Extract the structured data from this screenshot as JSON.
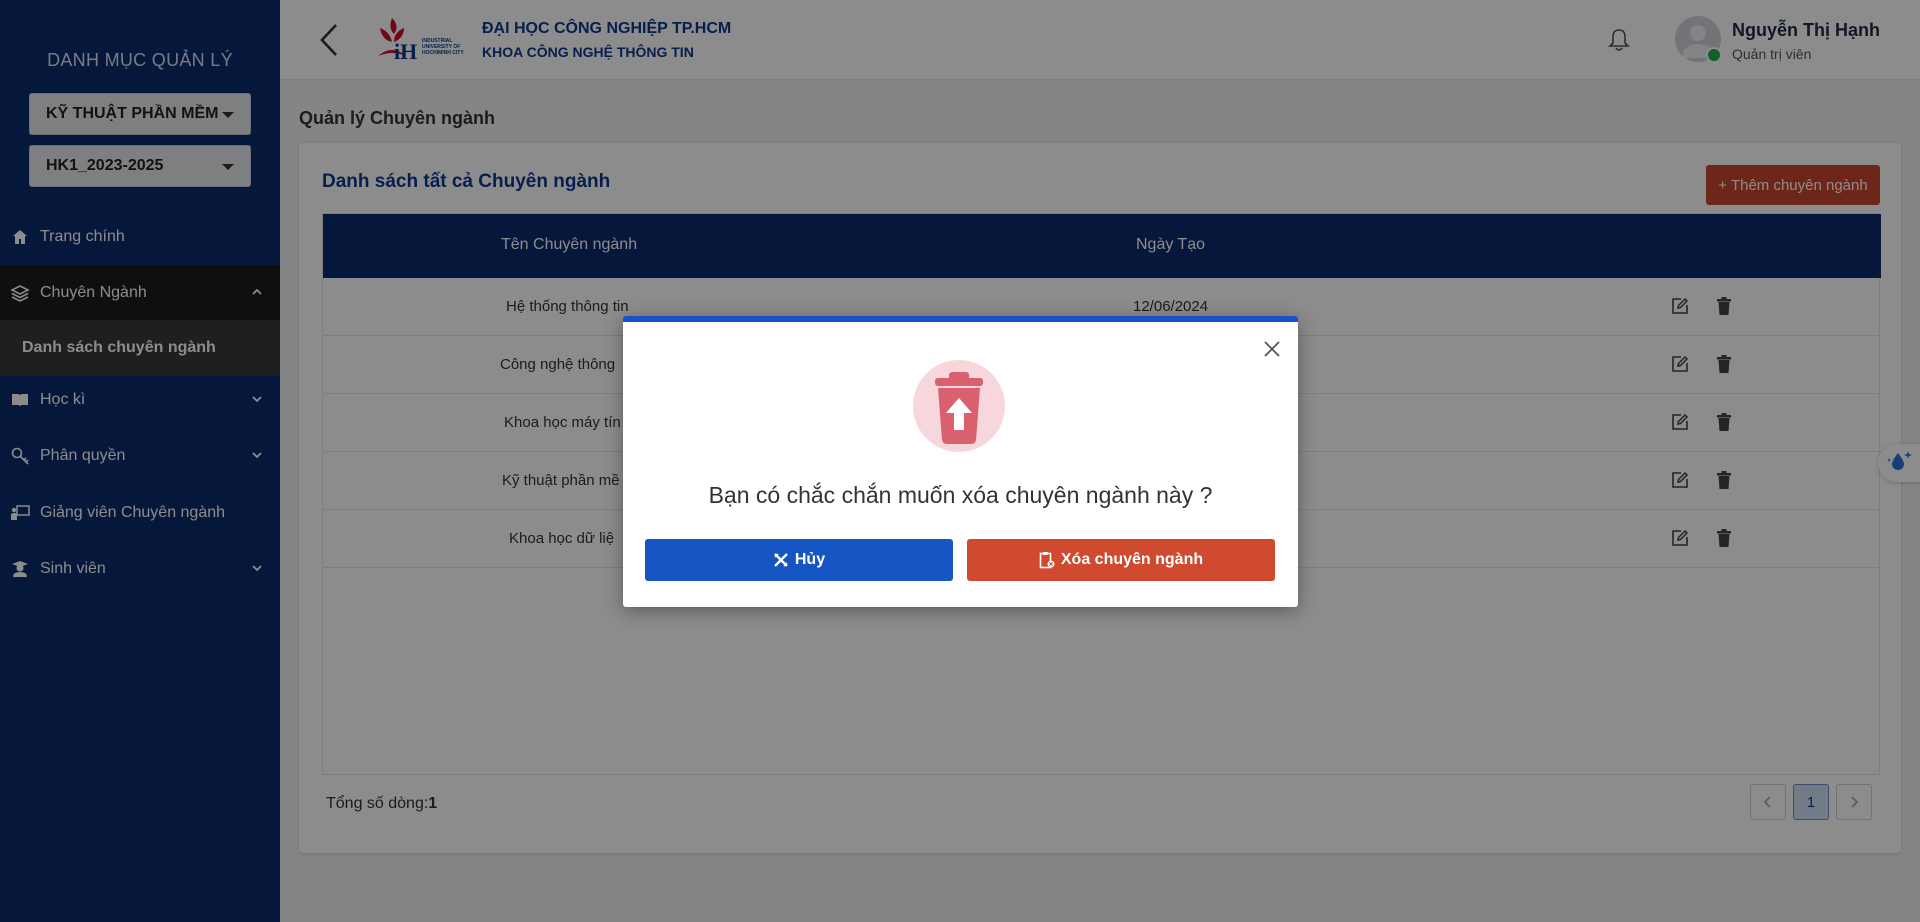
{
  "sidebar": {
    "title": "DANH MỤC QUẢN LÝ",
    "select_major": "KỸ THUẬT PHẦN MỀM",
    "select_term": "HK1_2023-2025",
    "items": [
      {
        "label": "Trang chính"
      },
      {
        "label": "Chuyên Ngành"
      },
      {
        "label": "Danh sách chuyên ngành"
      },
      {
        "label": "Học kì"
      },
      {
        "label": "Phân quyền"
      },
      {
        "label": "Giảng viên Chuyên ngành"
      },
      {
        "label": "Sinh viên"
      }
    ]
  },
  "header": {
    "university": "ĐẠI HỌC CÔNG NGHIỆP TP.HCM",
    "faculty": "KHOA CÔNG NGHỆ THÔNG TIN",
    "user_name": "Nguyễn Thị Hạnh",
    "user_role": "Quản trị viên"
  },
  "main": {
    "page_title": "Quản lý Chuyên ngành",
    "card_title": "Danh sách tất cả Chuyên ngành",
    "add_button": "+ Thêm chuyên ngành",
    "columns": [
      "Tên Chuyên ngành",
      "Ngày Tạo"
    ],
    "rows": [
      {
        "name": "Hệ thống thông tin",
        "date": "12/06/2024"
      },
      {
        "name": "Công nghệ thông",
        "date": ""
      },
      {
        "name": "Khoa học máy tín",
        "date": ""
      },
      {
        "name": "Kỹ thuật phần mề",
        "date": ""
      },
      {
        "name": "Khoa học dữ liệ",
        "date": ""
      }
    ],
    "total_label": "Tổng số dòng:",
    "total_value": "1",
    "current_page": "1"
  },
  "modal": {
    "question": "Bạn có chắc chắn muốn xóa chuyên ngành này ?",
    "cancel_label": "Hủy",
    "delete_label": "Xóa chuyên ngành"
  },
  "colors": {
    "sidebar_bg": "#0a2a6b",
    "primary": "#1555c4",
    "danger": "#d04a2f"
  }
}
